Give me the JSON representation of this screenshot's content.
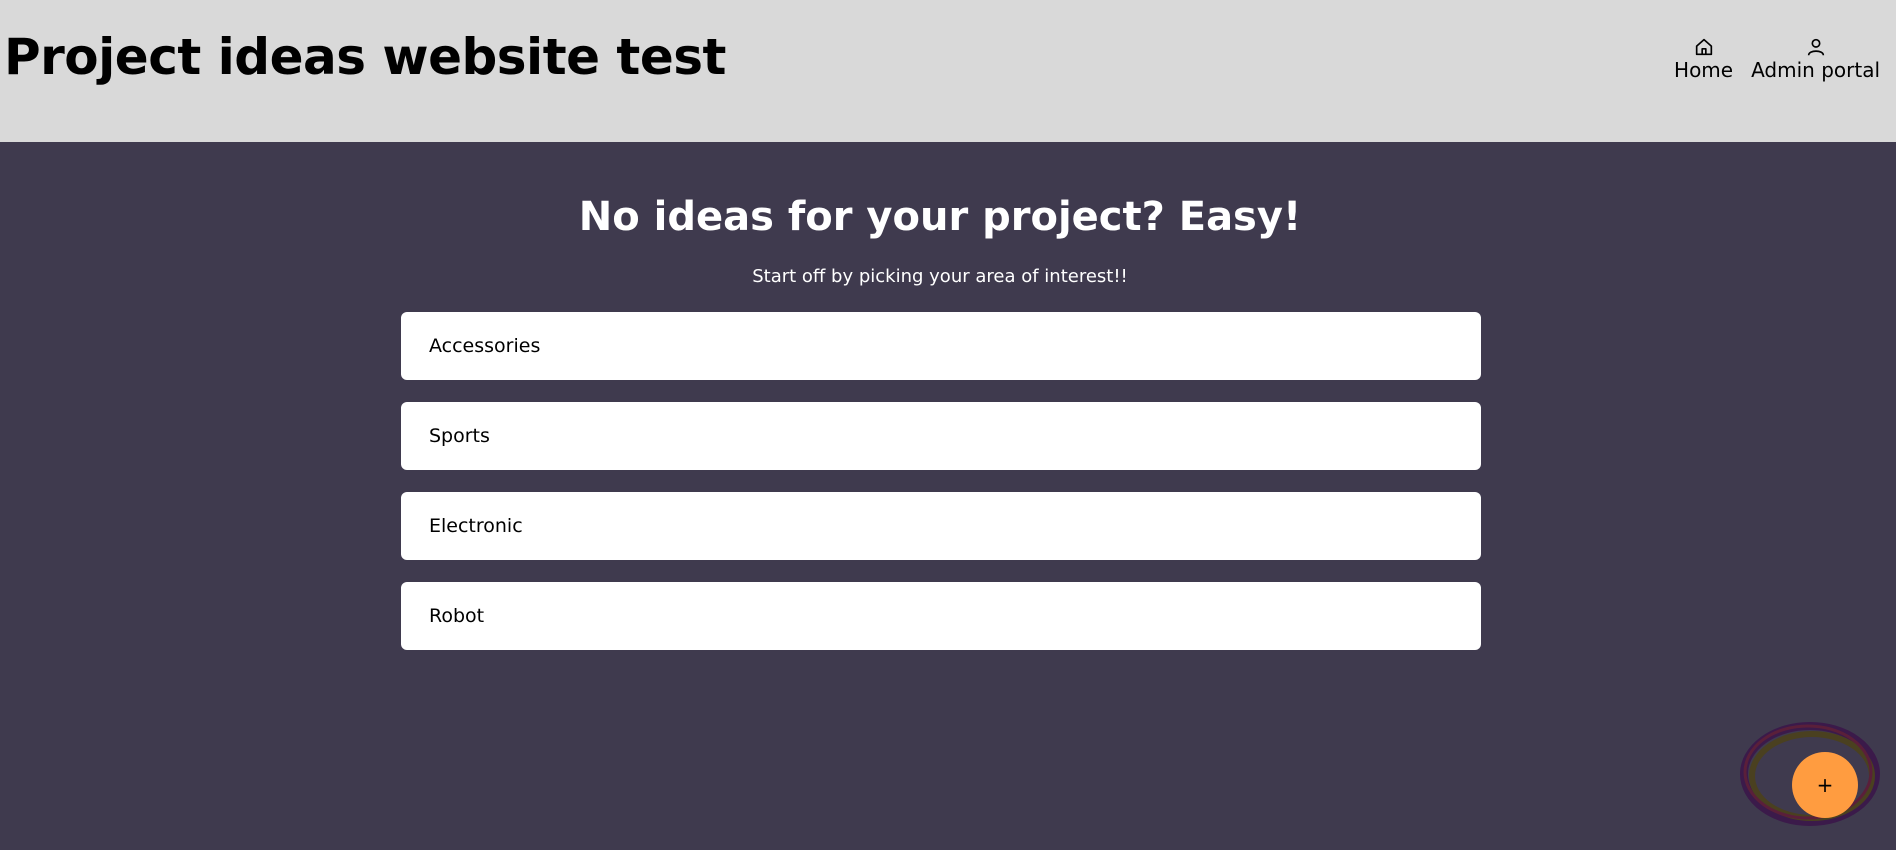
{
  "header": {
    "title": "Project ideas website test",
    "nav": [
      {
        "label": "Home",
        "icon": "home-icon"
      },
      {
        "label": "Admin portal",
        "icon": "user-icon"
      }
    ]
  },
  "main": {
    "heading": "No ideas for your project? Easy!",
    "subheading": "Start off by picking your area of interest!!",
    "categories": [
      {
        "label": "Accessories"
      },
      {
        "label": "Sports"
      },
      {
        "label": "Electronic"
      },
      {
        "label": "Robot"
      }
    ]
  },
  "fab": {
    "label": "+",
    "color": "#ff9c40"
  },
  "colors": {
    "header_bg": "#d9d9d9",
    "main_bg": "#3f3a4e",
    "card_bg": "#ffffff",
    "accent": "#ff9c40"
  }
}
